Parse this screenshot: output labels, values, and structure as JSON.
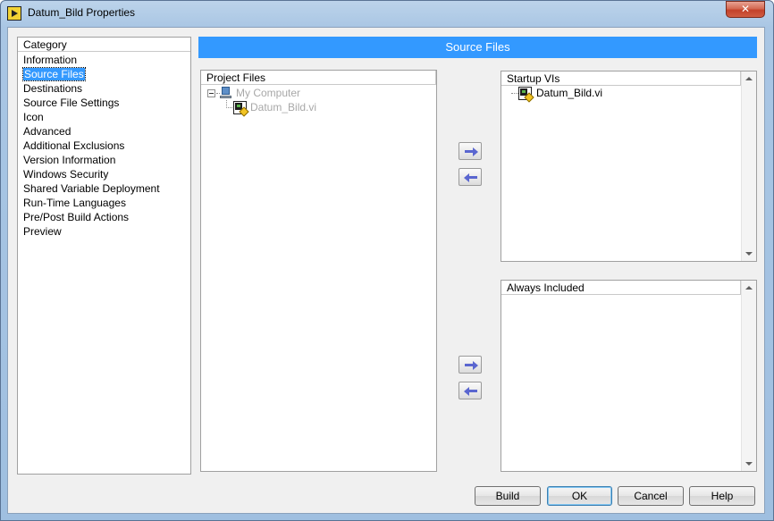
{
  "window": {
    "title": "Datum_Bild Properties",
    "close_glyph": "✕"
  },
  "category": {
    "header": "Category",
    "items": [
      "Information",
      "Source Files",
      "Destinations",
      "Source File Settings",
      "Icon",
      "Advanced",
      "Additional Exclusions",
      "Version Information",
      "Windows Security",
      "Shared Variable Deployment",
      "Run-Time Languages",
      "Pre/Post Build Actions",
      "Preview"
    ],
    "selected_index": 1
  },
  "panel": {
    "banner": "Source Files"
  },
  "project_files": {
    "header": "Project Files",
    "root": "My Computer",
    "child": "Datum_Bild.vi"
  },
  "startup_vis": {
    "header": "Startup VIs",
    "items": [
      "Datum_Bild.vi"
    ]
  },
  "always_included": {
    "header": "Always Included"
  },
  "buttons": {
    "build": "Build",
    "ok": "OK",
    "cancel": "Cancel",
    "help": "Help"
  }
}
